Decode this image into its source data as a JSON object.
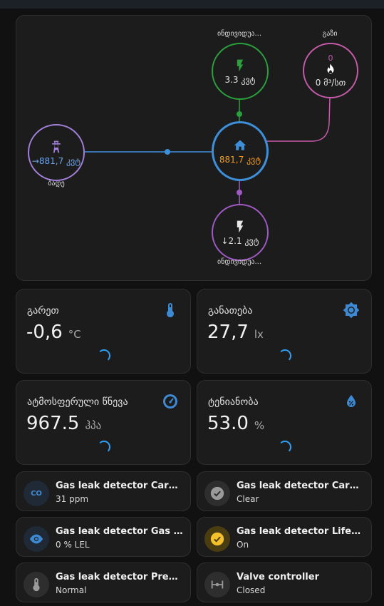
{
  "energy": {
    "solar_top": {
      "label": "ინდივიდუა...",
      "value": "3.3 კვტ"
    },
    "gas": {
      "label": "გაზი",
      "top_value": "0",
      "value": "0 მ³/სთ"
    },
    "grid": {
      "label": "ბადე",
      "value": "→881,7 კვტ"
    },
    "home": {
      "value": "881,7 კვტ"
    },
    "solar_bottom": {
      "label": "ინდივიდუა...",
      "value": "↓2.1 კვტ"
    }
  },
  "sensors": [
    {
      "title": "გარეთ",
      "value": "-0,6",
      "unit": "°C",
      "icon": "thermometer-icon"
    },
    {
      "title": "განათება",
      "value": "27,7",
      "unit": "lx",
      "icon": "brightness-icon"
    },
    {
      "title": "ატმოსფერული წნევა",
      "value": "967.5",
      "unit": "ჰპა",
      "icon": "gauge-icon"
    },
    {
      "title": "ტენიანობა",
      "value": "53.0",
      "unit": "%",
      "icon": "water-percent-icon"
    }
  ],
  "tiles": [
    {
      "name": "Gas leak detector Carbon ...",
      "state": "31 ppm",
      "icon": "co-icon"
    },
    {
      "name": "Gas leak detector Carbon ...",
      "state": "Clear",
      "icon": "check-circle-icon"
    },
    {
      "name": "Gas leak detector Gas leak",
      "state": "0 % LEL",
      "icon": "eye-icon"
    },
    {
      "name": "Gas leak detector Lifecycle",
      "state": "On",
      "icon": "check-circle-icon"
    },
    {
      "name": "Gas leak detector Preheat",
      "state": "Normal",
      "icon": "thermometer-icon"
    },
    {
      "name": "Valve controller",
      "state": "Closed",
      "icon": "valve-icon"
    }
  ],
  "colors": {
    "grid": "#a280db",
    "home": "#3e8fd9",
    "solar": "#2aa13d",
    "gas": "#c55aa8",
    "battery": "#a05ac5",
    "home_value": "#f59a1b",
    "accent_blue": "#3d8ad3"
  }
}
